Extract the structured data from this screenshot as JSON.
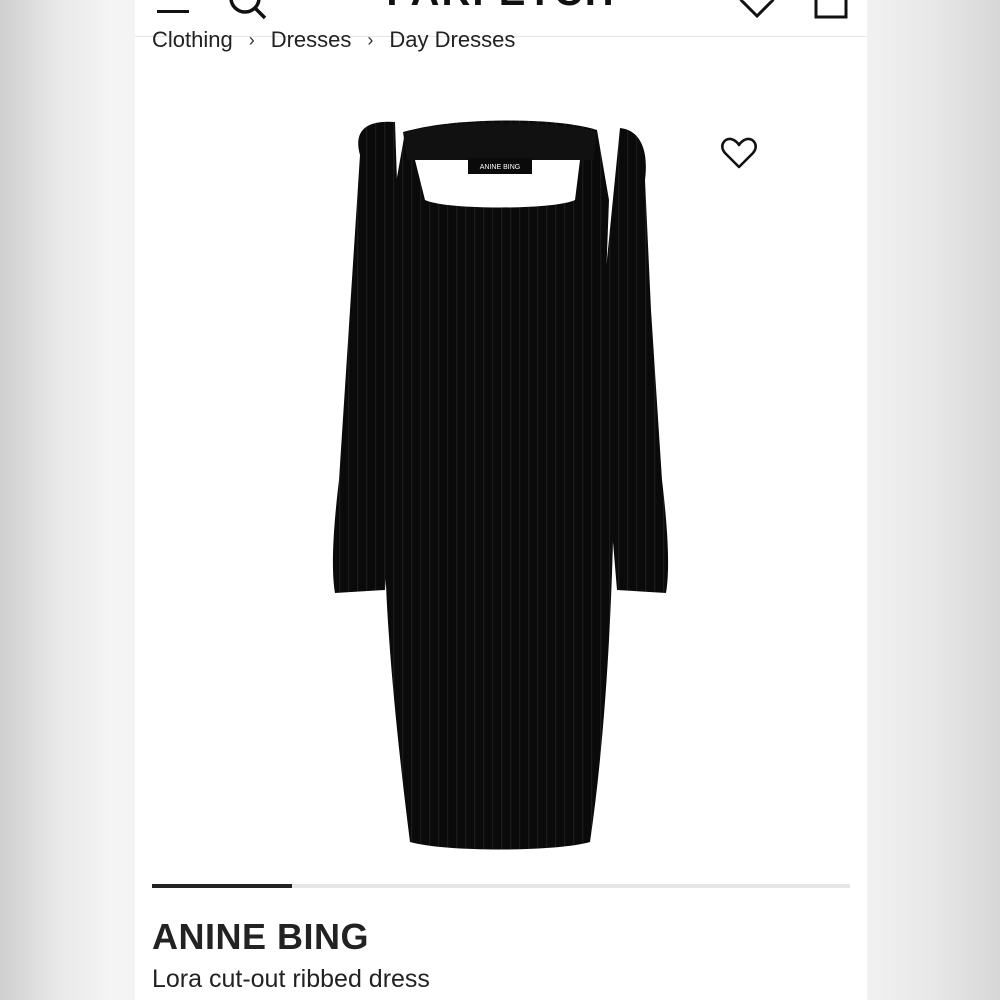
{
  "header": {
    "logo": "FARFETCH",
    "menu_icon": "menu-icon",
    "search_icon": "search-icon",
    "wishlist_icon": "heart-icon",
    "bag_icon": "bag-icon"
  },
  "breadcrumb": {
    "items": [
      "Clothing",
      "Dresses",
      "Day Dresses"
    ],
    "separator": "›"
  },
  "product": {
    "image_label": "ANINE BING",
    "wishlist_icon": "heart-icon",
    "brand": "ANINE BING",
    "name": "Lora cut-out ribbed dress",
    "gallery_progress": 0.2
  },
  "colors": {
    "text": "#222222",
    "garment": "#0a0a0a",
    "track": "#e6e6e6"
  }
}
